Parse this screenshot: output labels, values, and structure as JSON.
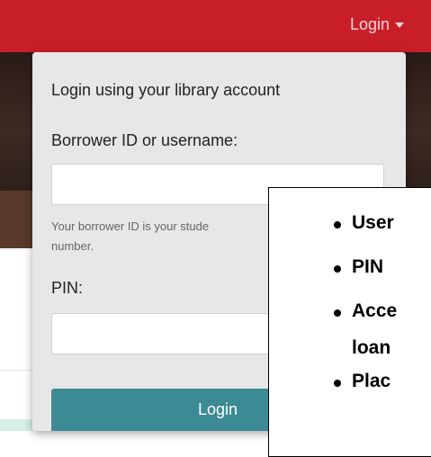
{
  "header": {
    "login_label": "Login",
    "accent_color": "#c81e2a"
  },
  "login_dropdown": {
    "title": "Login using your library account",
    "borrower_label": "Borrower ID or username:",
    "borrower_value": "",
    "help_text": "Your borrower ID is your stude number.",
    "help_line1": "Your borrower ID is your stude",
    "help_line2": "number.",
    "pin_label": "PIN:",
    "pin_value": "",
    "submit_label": "Login",
    "button_color": "#3c8a94"
  },
  "callout": {
    "items": [
      "User",
      "PIN",
      "Acce",
      "loan",
      "Plac"
    ]
  }
}
